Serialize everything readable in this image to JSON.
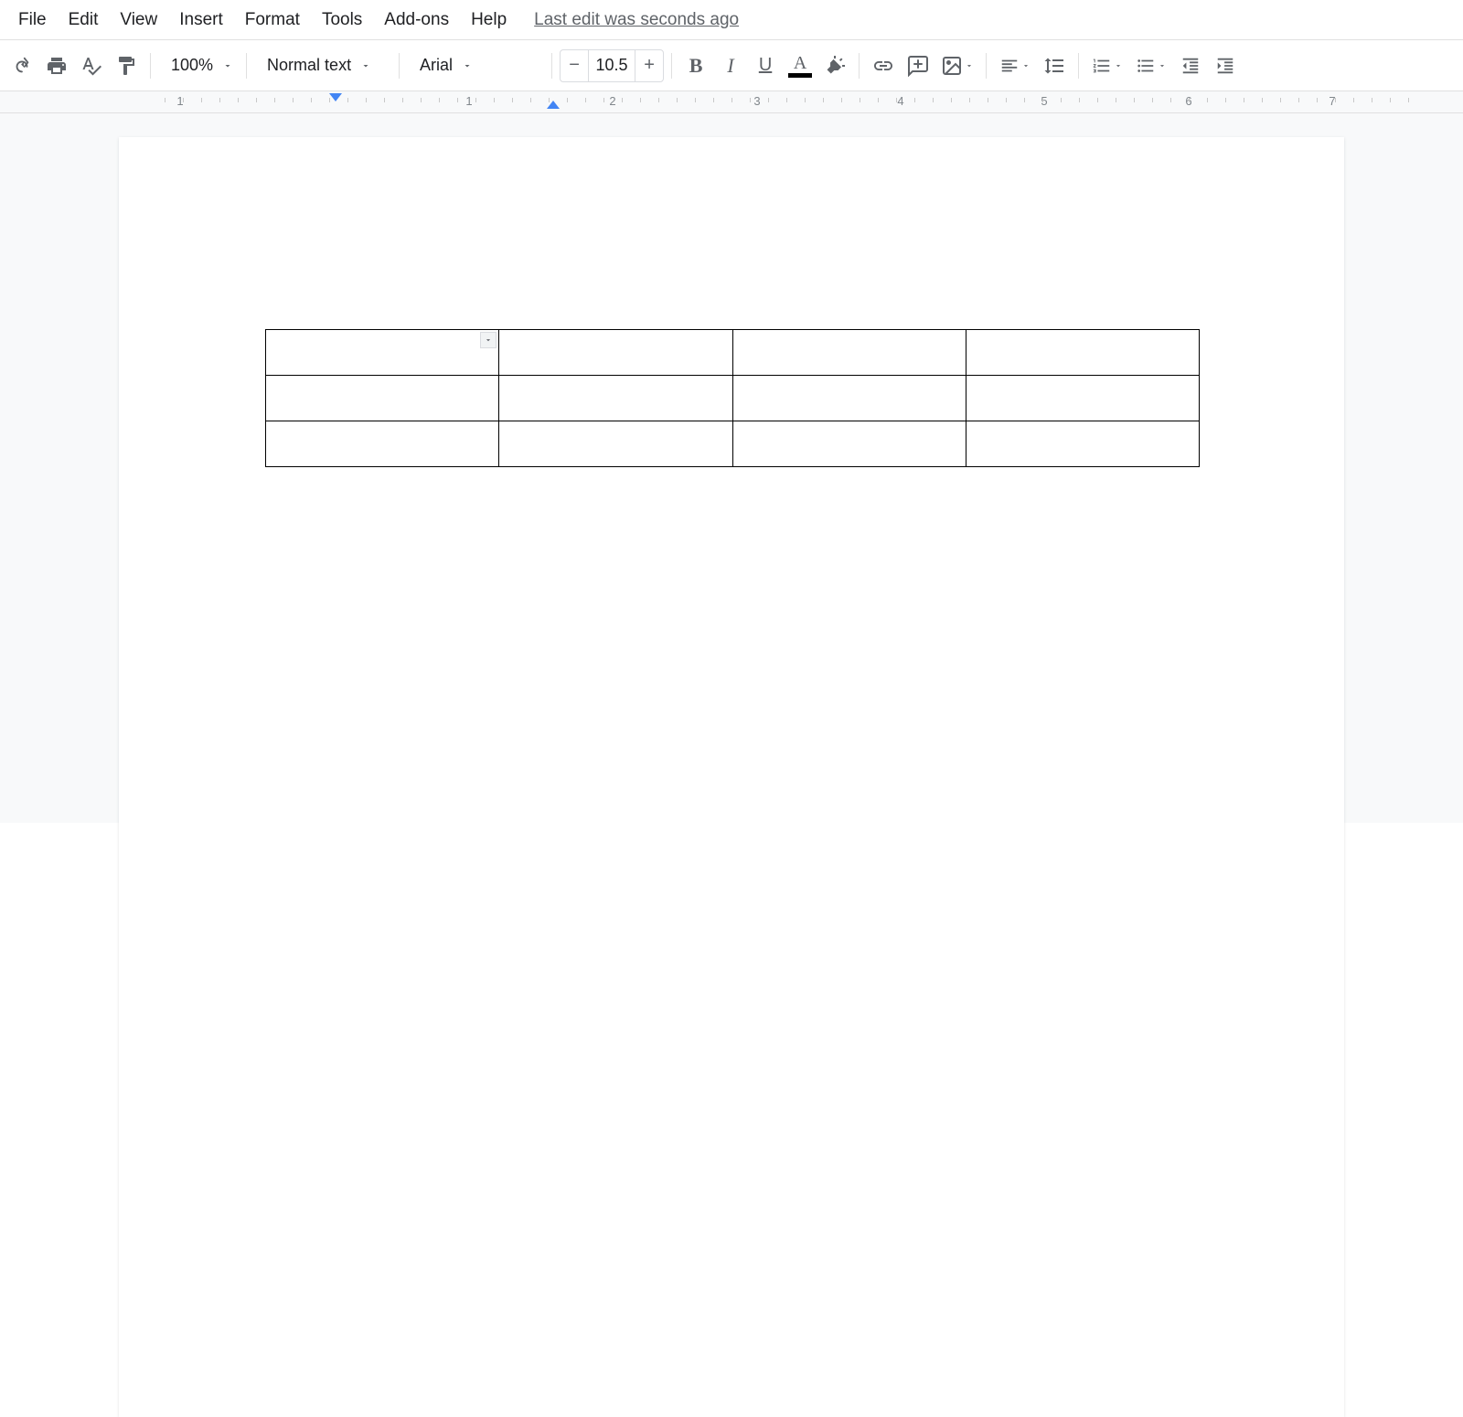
{
  "menu": {
    "file": "File",
    "edit": "Edit",
    "view": "View",
    "insert": "Insert",
    "format": "Format",
    "tools": "Tools",
    "addons": "Add-ons",
    "help": "Help",
    "last_edit": "Last edit was seconds ago"
  },
  "toolbar": {
    "zoom": "100%",
    "style": "Normal text",
    "font": "Arial",
    "font_size": "10.5"
  },
  "ruler": {
    "marks": [
      "1",
      "1",
      "2",
      "3",
      "4",
      "5",
      "6",
      "7"
    ]
  },
  "table": {
    "rows": 3,
    "cols": 4
  }
}
